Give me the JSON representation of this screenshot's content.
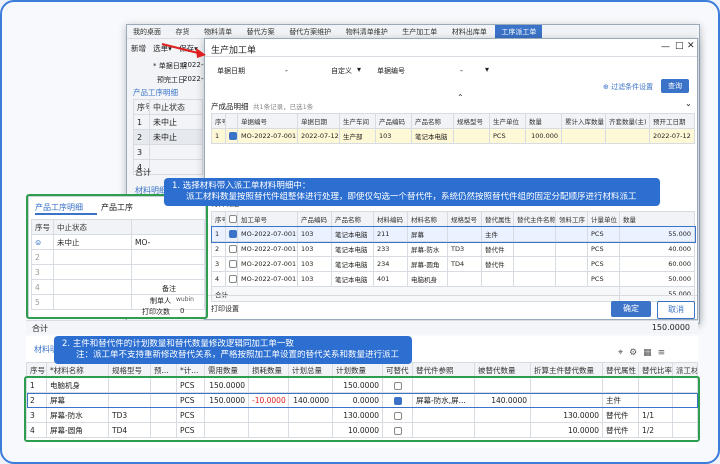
{
  "back_tabs": [
    "我的桌面",
    "存货",
    "物料清单",
    "替代方案",
    "替代方案维护",
    "物料清单维护",
    "生产加工单",
    "材料出库单",
    "工序派工单"
  ],
  "back_toolbar": [
    "新增",
    "选单",
    "保存"
  ],
  "back_form": {
    "date_label": "* 单据日期",
    "date_value": "2022-07",
    "plan_label": "预完工日",
    "plan_value": "2022-07"
  },
  "back_section_tab": "产品工序明细",
  "back_table": {
    "headers": [
      "序号",
      "中止状态"
    ],
    "rows": [
      [
        "1",
        "未中止"
      ],
      [
        "2",
        "未中止"
      ],
      [
        "3",
        ""
      ],
      [
        "4",
        ""
      ],
      [
        "5",
        ""
      ]
    ]
  },
  "back_total": "合计",
  "back_materials_tab": "材料明细",
  "modal": {
    "title": "生产加工单",
    "filter": {
      "date_label": "单据日期",
      "date_dash": "-",
      "date_range": "自定义",
      "code_label": "单据编号",
      "code_dash": "-",
      "setting": "过滤条件设置",
      "query": "查询"
    },
    "products": {
      "title": "产成品明细",
      "info": "共1条记录，已选1条",
      "headers": [
        "序号",
        "",
        "单据编号",
        "单据日期",
        "生产车间",
        "产品编码",
        "产品名称",
        "规格型号",
        "生产单位",
        "数量",
        "累计入库数量",
        "齐套数量(主)",
        "预开工日期"
      ],
      "row": [
        "1",
        "",
        "MO-2022-07-0011",
        "2022-07-12",
        "生产部",
        "103",
        "笔记本电脑",
        "",
        "PCS",
        "100.000",
        "",
        "",
        "2022-07-12"
      ]
    },
    "materials": {
      "title": "材料明细",
      "headers": [
        "序号",
        "",
        "加工单号",
        "产品编码",
        "产品名称",
        "材料编码",
        "材料名称",
        "规格型号",
        "替代属性",
        "替代主件名称",
        "领料工序",
        "计量单位",
        "数量"
      ],
      "rows": [
        [
          "1",
          "",
          "MO-2022-07-0011",
          "103",
          "笔记本电脑",
          "211",
          "屏幕",
          "",
          "主件",
          "",
          "",
          "PCS",
          "55.000"
        ],
        [
          "2",
          "",
          "MO-2022-07-0011",
          "103",
          "笔记本电脑",
          "233",
          "屏幕-防水",
          "TD3",
          "替代件",
          "",
          "",
          "PCS",
          "40.000"
        ],
        [
          "3",
          "",
          "MO-2022-07-0011",
          "103",
          "笔记本电脑",
          "234",
          "屏幕-圆角",
          "TD4",
          "替代件",
          "",
          "",
          "PCS",
          "60.000"
        ],
        [
          "4",
          "",
          "MO-2022-07-0011",
          "103",
          "笔记本电脑",
          "401",
          "电脑机身",
          "",
          "",
          "",
          "",
          "PCS",
          "50.000"
        ]
      ],
      "total_label": "合计",
      "total_value": "55.000"
    },
    "print_setting": "打印设置",
    "confirm": "确定",
    "cancel": "取消"
  },
  "front": {
    "tab_active": "产品工序明细",
    "tab_other": "产品工序",
    "headers": [
      "序号",
      "中止状态"
    ],
    "rows": [
      [
        "1",
        "未中止",
        "MO-"
      ],
      [
        "2",
        ""
      ],
      [
        "3",
        ""
      ],
      [
        "4",
        ""
      ],
      [
        "5",
        ""
      ]
    ],
    "remark_label": "备注",
    "maker_label": "制单人",
    "maker_value": "wubin",
    "print_label": "打印次数",
    "print_value": "0"
  },
  "total_bar": {
    "label": "合计",
    "value": "150.0000"
  },
  "bottom": {
    "tab": "材料明",
    "headers": [
      "序号",
      "*材料名称",
      "规格型号",
      "预...",
      "*计...",
      "需用数量",
      "损耗数量",
      "计划总量",
      "计划数量",
      "可替代",
      "替代件参照",
      "被替代数量",
      "折算主件替代数量",
      "替代属性",
      "替代比率",
      "派工材"
    ],
    "rows": [
      [
        "1",
        "电脑机身",
        "",
        "",
        "PCS",
        "150.0000",
        "",
        "",
        "150.0000",
        "",
        "",
        "",
        "",
        "",
        "",
        ""
      ],
      [
        "2",
        "屏幕",
        "",
        "",
        "PCS",
        "150.0000",
        "-10.0000",
        "140.0000",
        "0.0000",
        "",
        "屏幕-防水,屏...",
        "140.0000",
        "",
        "主件",
        "",
        ""
      ],
      [
        "3",
        "屏幕-防水",
        "TD3",
        "",
        "PCS",
        "",
        "",
        "",
        "130.0000",
        "",
        "",
        "",
        "130.0000",
        "替代件",
        "1/1",
        ""
      ],
      [
        "4",
        "屏幕-圆角",
        "TD4",
        "",
        "PCS",
        "",
        "",
        "",
        "10.0000",
        "",
        "",
        "",
        "10.0000",
        "替代件",
        "1/2",
        ""
      ]
    ]
  },
  "callout1": {
    "line1": "1. 选择材料带入派工单材料明细中：",
    "line2": "派工材料数量按照替代件组整体进行处理，即使仅勾选一个替代件，系统仍然按照替代件组的固定分配顺序进行材料派工"
  },
  "callout2": {
    "line1": "2. 主件和替代件的计划数量和替代数量修改逻辑同加工单一致",
    "line2": "注：派工单不支持重新修改替代关系，严格按照加工单设置的替代关系和数量进行派工"
  },
  "colors": {
    "accent": "#3a73c7",
    "callout": "#2d6fd1",
    "green": "#2e9d4e",
    "red": "#e02020"
  }
}
